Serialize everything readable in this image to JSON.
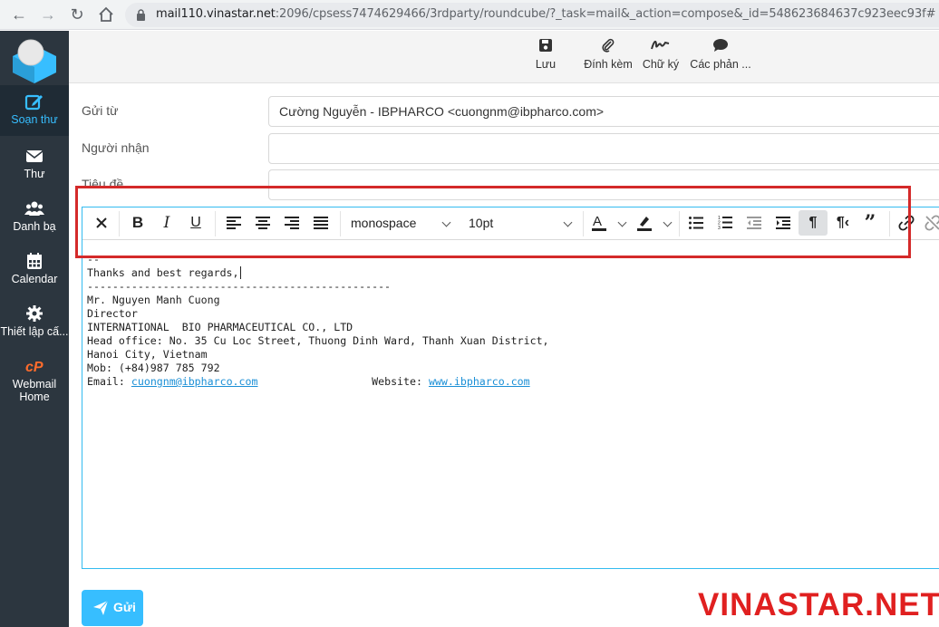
{
  "browser": {
    "url_host": "mail110.vinastar.net",
    "url_rest": ":2096/cpsess7474629466/3rdparty/roundcube/?_task=mail&_action=compose&_id=548623684637c923eec93f#"
  },
  "sidebar": {
    "items": [
      {
        "label": "Soạn thư",
        "icon": "compose-icon",
        "active": true
      },
      {
        "label": "Thư",
        "icon": "envelope-icon"
      },
      {
        "label": "Danh bạ",
        "icon": "contacts-icon"
      },
      {
        "label": "Calendar",
        "icon": "calendar-icon"
      },
      {
        "label": "Thiết lập cấ...",
        "icon": "gear-icon"
      },
      {
        "label": "Webmail",
        "label2": "Home",
        "icon": "cpanel-icon"
      }
    ]
  },
  "toolbar": {
    "save": "Lưu",
    "attach": "Đính kèm",
    "signature": "Chữ ký",
    "responses": "Các phản ..."
  },
  "form": {
    "from_label": "Gửi từ",
    "from_value": "Cường Nguyễn - IBPHARCO <cuongnm@ibpharco.com>",
    "to_label": "Người nhận",
    "to_value": "",
    "subject_label": "Tiêu đề",
    "subject_value": ""
  },
  "editor": {
    "font_family": "monospace",
    "font_size": "10pt",
    "body": {
      "l1": "--",
      "l2": "Thanks and best regards,",
      "l3": "------------------------------------------------",
      "l4": "Mr. Nguyen Manh Cuong",
      "l5": "Director",
      "l6": "INTERNATIONAL  BIO PHARMACEUTICAL CO., LTD",
      "l7": "Head office: No. 35 Cu Loc Street, Thuong Dinh Ward, Thanh Xuan District,",
      "l8": "Hanoi City, Vietnam",
      "l9": "Mob: (+84)987 785 792",
      "email_label": "Email: ",
      "email": "cuongnm@ibpharco.com",
      "gap": "                  ",
      "website_label": "Website: ",
      "website": "www.ibpharco.com"
    }
  },
  "send": {
    "label": "Gửi"
  },
  "watermark": "VINASTAR.NET",
  "colors": {
    "accent": "#37beff",
    "sidebar": "#2c363f",
    "highlight": "#d42a2a"
  }
}
